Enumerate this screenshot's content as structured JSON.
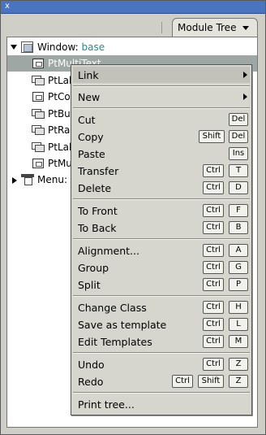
{
  "window": {
    "close_glyph": "x"
  },
  "tab": {
    "label": "Module Tree"
  },
  "tree": {
    "window_node": {
      "prefix": "Window:",
      "value": "base"
    },
    "children": [
      "PtMultiText",
      "PtLabel",
      "PtColorSel",
      "PtButton",
      "PtRaw",
      "PtLabel",
      "PtMultiText"
    ],
    "menu_node": {
      "label": "Menu:",
      "value": ""
    }
  },
  "context_menu": {
    "link": {
      "label": "Link"
    },
    "new": {
      "label": "New"
    },
    "cut": {
      "label": "Cut",
      "keys": [
        "Del"
      ]
    },
    "copy": {
      "label": "Copy",
      "keys": [
        "Shift",
        "Del"
      ]
    },
    "paste": {
      "label": "Paste",
      "keys": [
        "Ins"
      ]
    },
    "transfer": {
      "label": "Transfer",
      "keys": [
        "Ctrl",
        "T"
      ]
    },
    "delete": {
      "label": "Delete",
      "keys": [
        "Ctrl",
        "D"
      ]
    },
    "to_front": {
      "label": "To Front",
      "keys": [
        "Ctrl",
        "F"
      ]
    },
    "to_back": {
      "label": "To Back",
      "keys": [
        "Ctrl",
        "B"
      ]
    },
    "alignment": {
      "label": "Alignment...",
      "keys": [
        "Ctrl",
        "A"
      ]
    },
    "group": {
      "label": "Group",
      "keys": [
        "Ctrl",
        "G"
      ]
    },
    "split": {
      "label": "Split",
      "keys": [
        "Ctrl",
        "P"
      ]
    },
    "change_class": {
      "label": "Change Class",
      "keys": [
        "Ctrl",
        "H"
      ]
    },
    "save_template": {
      "label": "Save as template",
      "keys": [
        "Ctrl",
        "L"
      ]
    },
    "edit_templates": {
      "label": "Edit Templates",
      "keys": [
        "Ctrl",
        "M"
      ]
    },
    "undo": {
      "label": "Undo",
      "keys": [
        "Ctrl",
        "Z"
      ]
    },
    "redo": {
      "label": "Redo",
      "keys": [
        "Ctrl",
        "Shift",
        "Z"
      ]
    },
    "print_tree": {
      "label": "Print tree..."
    }
  },
  "colors": {
    "titlebar": "#4a74bd",
    "selection": "#9fa7a5",
    "accent_value": "#2a8a8a"
  }
}
